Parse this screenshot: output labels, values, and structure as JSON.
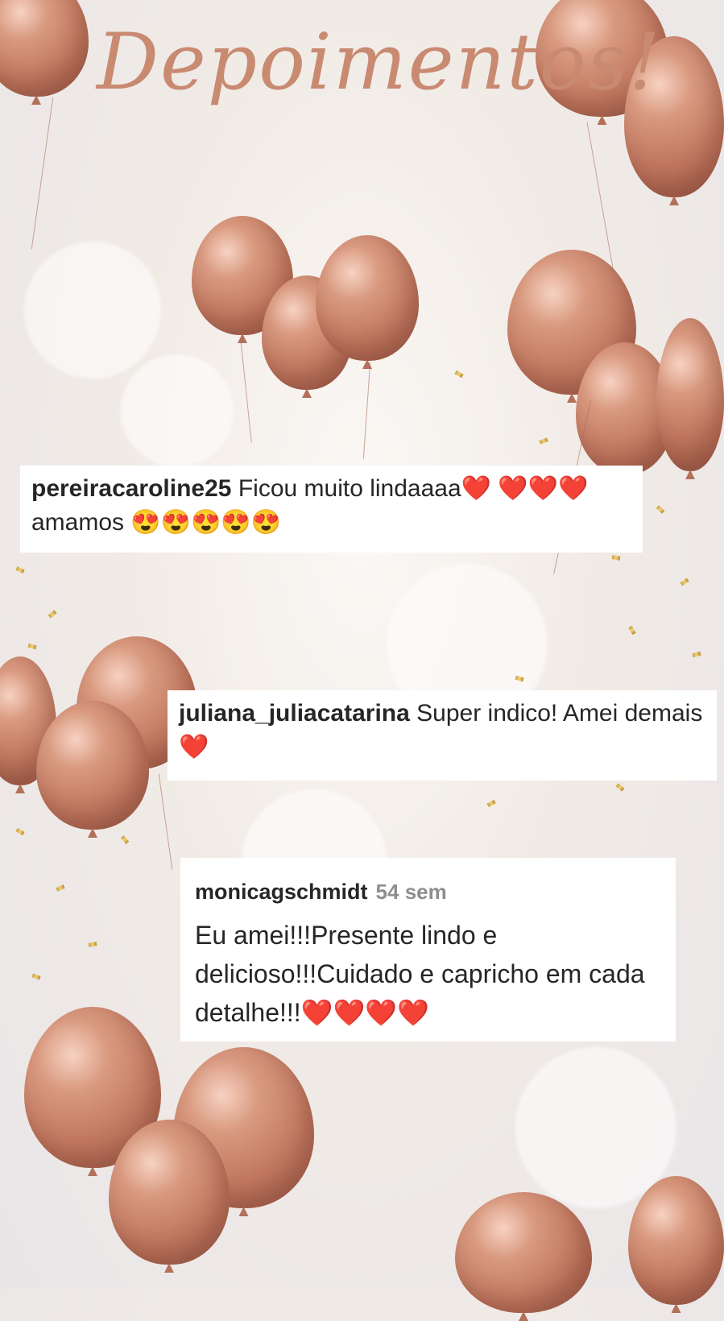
{
  "title": "Depoimentos!",
  "colors": {
    "title": "#c98a72",
    "balloon": "#c98466",
    "card_bg": "#ffffff",
    "meta": "#8e8e8e"
  },
  "testimonials": [
    {
      "user": "pereiracaroline25",
      "text": "Ficou muito lindaaaa❤️ ❤️❤️❤️ amamos 😍😍😍😍😍"
    },
    {
      "user": "juliana_juliacatarina",
      "text": "Super indico! Amei demais ❤️"
    },
    {
      "user": "monicagschmidt",
      "time": "54 sem",
      "text": "Eu amei!!!Presente lindo e delicioso!!!Cuidado e capricho em cada detalhe!!!❤️❤️❤️❤️"
    }
  ]
}
